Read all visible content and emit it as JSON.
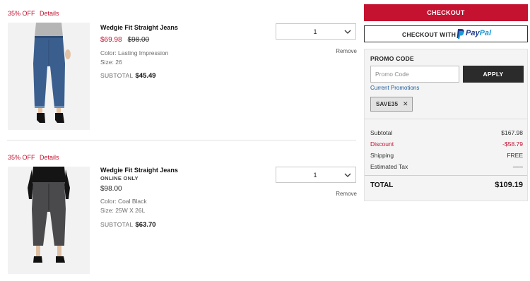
{
  "items": [
    {
      "discount": "35% OFF",
      "details_label": "Details",
      "name": "Wedgie Fit Straight Jeans",
      "online_only": "",
      "sale_price": "$69.98",
      "original_price": "$98.00",
      "color": "Color: Lasting Impression",
      "size": "Size: 26",
      "subtotal_label": "SUBTOTAL",
      "subtotal_value": "$45.49",
      "quantity": "1",
      "remove_label": "Remove",
      "image_icon": "jeans-product-photo",
      "jeans_color": "#3a5f8f"
    },
    {
      "discount": "35% OFF",
      "details_label": "Details",
      "name": "Wedgie Fit Straight Jeans",
      "online_only": "ONLINE ONLY",
      "price": "$98.00",
      "color": "Color: Coal Black",
      "size": "Size: 25W X 26L",
      "subtotal_label": "SUBTOTAL",
      "subtotal_value": "$63.70",
      "quantity": "1",
      "remove_label": "Remove",
      "image_icon": "jeans-product-photo",
      "jeans_color": "#4a4a4d"
    }
  ],
  "checkout": {
    "checkout_label": "CHECKOUT",
    "paypal_label": "CHECKOUT WITH",
    "paypal_brand_a": "Pay",
    "paypal_brand_b": "Pal"
  },
  "promo": {
    "title": "PROMO CODE",
    "placeholder": "Promo Code",
    "apply_label": "APPLY",
    "current_promotions": "Current Promotions",
    "applied_code": "SAVE35",
    "remove_icon": "close-icon"
  },
  "summary": {
    "subtotal_label": "Subtotal",
    "subtotal_value": "$167.98",
    "discount_label": "Discount",
    "discount_value": "-$58.79",
    "shipping_label": "Shipping",
    "shipping_value": "FREE",
    "tax_label": "Estimated Tax",
    "tax_value": "–––",
    "total_label": "TOTAL",
    "total_value": "$109.19"
  },
  "colors": {
    "accent_red": "#c41230",
    "apply_dark": "#2b2b2b",
    "link_blue": "#1d5c9e"
  }
}
